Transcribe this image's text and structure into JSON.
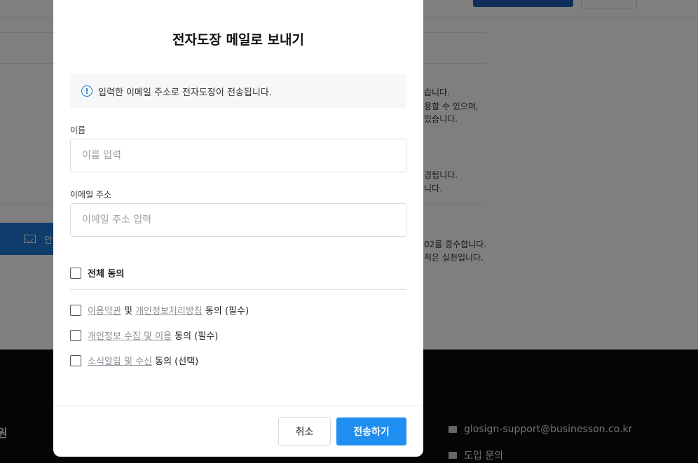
{
  "background": {
    "side_button_label": "안",
    "right_text_lines": [
      "습니다.",
      "용할 수 있으며,",
      "있습니다.",
      "경됩니다.",
      "니다.",
      "02를 증수합니다.",
      "적은 실천입니다."
    ],
    "footer": {
      "member_label": "원",
      "support_email": "glosign-support@businesson.co.kr",
      "inquiry_label": "도입 문의"
    }
  },
  "modal": {
    "title": "전자도장 메일로 보내기",
    "info_text": "입력한 이메일 주소로 전자도장이 전송됩니다.",
    "name_label": "이름",
    "name_placeholder": "이름 입력",
    "email_label": "이메일 주소",
    "email_placeholder": "이메일 주소 입력",
    "agree_all": "전체 동의",
    "agreements": [
      {
        "link1": "이용약관",
        "mid": " 및 ",
        "link2": "개인정보처리방침",
        "suffix": " 동의 (필수)"
      },
      {
        "link1": "개인정보 수집 및 이용",
        "suffix": " 동의 (필수)"
      },
      {
        "link1": "소식알림 및 수신",
        "suffix": " 동의 (선택)"
      }
    ],
    "cancel_label": "취소",
    "send_label": "전송하기"
  },
  "colors": {
    "primary": "#1e8ef0",
    "info_icon": "#1e78d7",
    "overlay": "rgba(0,0,0,0.5)"
  }
}
